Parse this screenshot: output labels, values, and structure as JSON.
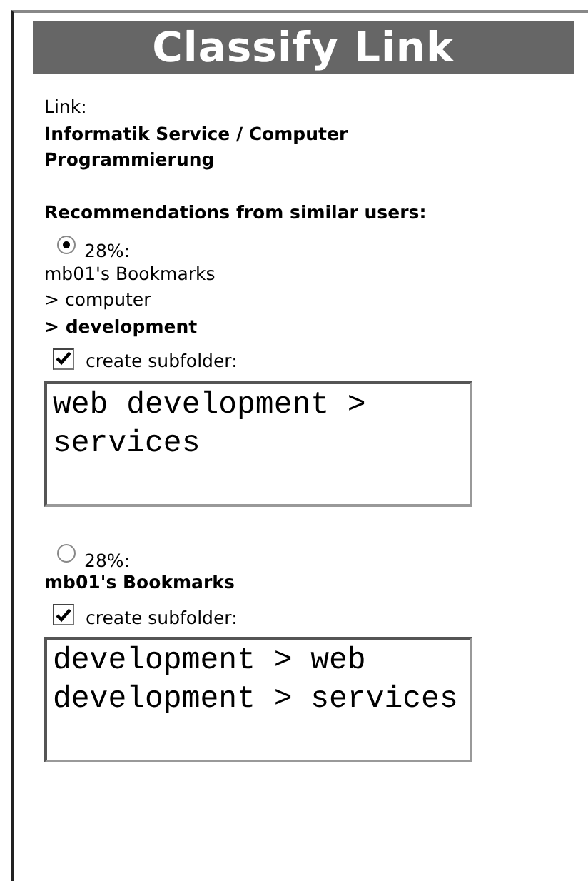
{
  "title": "Classify Link",
  "link": {
    "label": "Link:",
    "value": "Informatik Service / Computer Programmierung"
  },
  "recommendations_heading": "Recommendations from similar users:",
  "recommendations": [
    {
      "selected": true,
      "percent": "28%:",
      "path": [
        "mb01's Bookmarks",
        "> computer",
        "> development"
      ],
      "create_subfolder": {
        "checked": true,
        "label": "create subfolder:"
      },
      "subfolder": "web development > services"
    },
    {
      "selected": false,
      "percent": "28%:",
      "path": [
        "mb01's Bookmarks"
      ],
      "create_subfolder": {
        "checked": true,
        "label": "create subfolder:"
      },
      "subfolder": "development > web development > services"
    }
  ]
}
